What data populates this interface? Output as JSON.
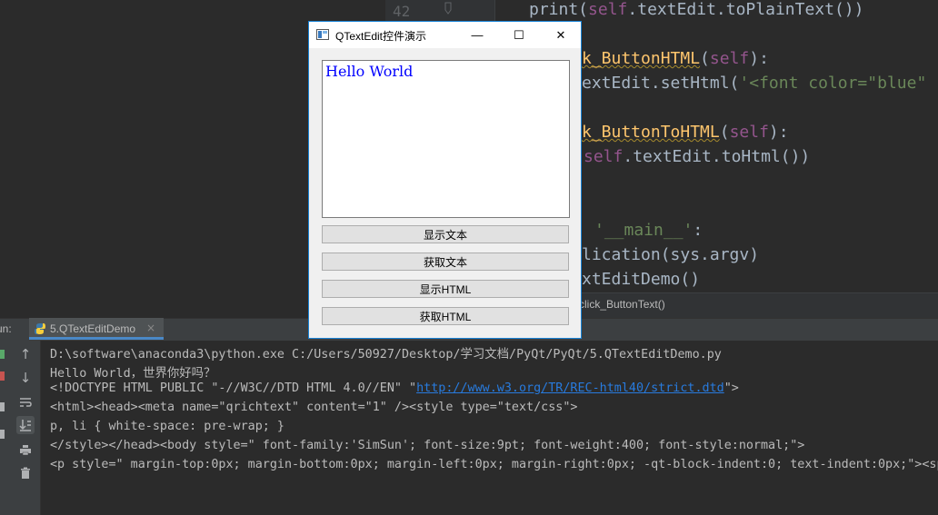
{
  "editor": {
    "line_number": "42",
    "code_lines": [
      {
        "parts": [
          {
            "t": "print(",
            "c": ""
          },
          {
            "t": "self",
            "c": "kw-self"
          },
          {
            "t": ".textEdit.toPlainText())",
            "c": ""
          }
        ]
      },
      {
        "parts": [
          {
            "t": "k_ButtonHTML",
            "c": "fn"
          },
          {
            "t": "(",
            "c": ""
          },
          {
            "t": "self",
            "c": "kw-self"
          },
          {
            "t": "):",
            "c": ""
          }
        ]
      },
      {
        "parts": [
          {
            "t": "extEdit.setHtml(",
            "c": ""
          },
          {
            "t": "'<font color=\"blue\" siz",
            "c": "str"
          }
        ]
      },
      {
        "parts": [
          {
            "t": "k_ButtonToHTML",
            "c": "fn"
          },
          {
            "t": "(",
            "c": ""
          },
          {
            "t": "self",
            "c": "kw-self"
          },
          {
            "t": "):",
            "c": ""
          }
        ]
      },
      {
        "parts": [
          {
            "t": "self",
            "c": "kw-self"
          },
          {
            "t": ".textEdit.toHtml())",
            "c": ""
          }
        ]
      },
      {
        "parts": [
          {
            "t": "'__main__'",
            "c": "str"
          },
          {
            "t": ":",
            "c": ""
          }
        ]
      },
      {
        "parts": [
          {
            "t": "lication(sys.argv)",
            "c": ""
          }
        ]
      },
      {
        "parts": [
          {
            "t": "xtEditDemo()",
            "c": ""
          }
        ]
      }
    ],
    "breadcrumb": "click_ButtonText()"
  },
  "run_panel": {
    "label": "un:",
    "tab_label": "5.QTextEditDemo",
    "tab_close": "×",
    "console_lines": [
      "D:\\software\\anaconda3\\python.exe C:/Users/50927/Desktop/学习文档/PyQt/PyQt/5.QTextEditDemo.py",
      "Hello World，世界你好吗？",
      "",
      "<html><head><meta name=\"qrichtext\" content=\"1\" /><style type=\"text/css\">",
      "p, li { white-space: pre-wrap; }",
      "</style></head><body style=\" font-family:'SimSun'; font-size:9pt; font-weight:400; font-style:normal;\">",
      "<p style=\" margin-top:0px; margin-bottom:0px; margin-left:0px; margin-right:0px; -qt-block-indent:0; text-indent:0px;\"><sp"
    ],
    "doctype_pre": "<!DOCTYPE HTML PUBLIC \"-//W3C//DTD HTML 4.0//EN\" \"",
    "doctype_link": "http://www.w3.org/TR/REC-html40/strict.dtd",
    "doctype_post": "\">"
  },
  "qt_window": {
    "title": "QTextEdit控件演示",
    "minimize": "—",
    "maximize": "☐",
    "close": "✕",
    "text_content": "Hello World",
    "buttons": [
      "显示文本",
      "获取文本",
      "显示HTML",
      "获取HTML"
    ]
  },
  "colors": {
    "ide_bg": "#2b2b2b",
    "accent": "#1883d7",
    "textedit_text": "#0000ff"
  },
  "icons": {
    "tool_icons": [
      "arrow-up-icon",
      "arrow-down-icon",
      "soft-wrap-icon",
      "scroll-to-end-icon",
      "print-icon",
      "trash-icon"
    ]
  }
}
